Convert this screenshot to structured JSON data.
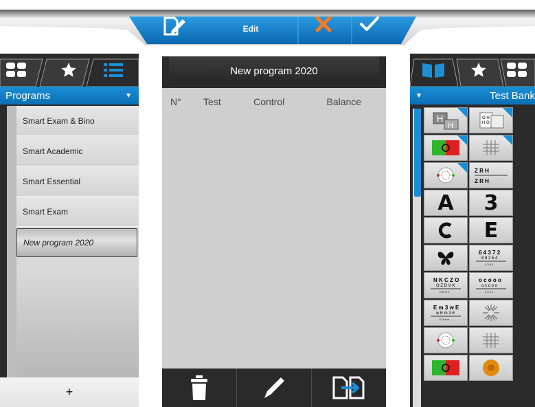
{
  "toolbar": {
    "edit_label": "Edit"
  },
  "left_panel": {
    "header_label": "Programs",
    "header_caret": "▼",
    "programs": [
      {
        "label": "Smart Exam & Bino"
      },
      {
        "label": "Smart Academic"
      },
      {
        "label": "Smart Essential"
      },
      {
        "label": "Smart Exam"
      },
      {
        "label": "New program 2020",
        "selected": true
      }
    ],
    "add_label": "+"
  },
  "center_panel": {
    "title": "New program 2020",
    "columns": {
      "no": "N°",
      "test": "Test",
      "control": "Control",
      "balance": "Balance"
    }
  },
  "right_panel": {
    "header_caret": "▼",
    "header_label": "Test Bank",
    "tiles": [
      {
        "icon": "h-duochrome-tile-icon",
        "flag": true
      },
      {
        "icon": "letter-grid-tile-icon",
        "flag": true
      },
      {
        "icon": "red-green-tile-icon",
        "flag": true
      },
      {
        "icon": "cross-grid-tile-icon",
        "flag": true
      },
      {
        "icon": "dot-circle-tile-icon",
        "flag": true
      },
      {
        "icon": "zrho-chart-tile-icon",
        "flag": false
      },
      {
        "icon": "letter-a-tile-icon",
        "text": "A"
      },
      {
        "icon": "letter-3-tile-icon",
        "text": "Ɛ"
      },
      {
        "icon": "landolt-c-tile-icon",
        "text": "C"
      },
      {
        "icon": "letter-e-tile-icon",
        "text": "E"
      },
      {
        "icon": "butterfly-tile-icon",
        "text": "🦋"
      },
      {
        "icon": "number-chart-tile-icon"
      },
      {
        "icon": "letter-chart-tile-icon"
      },
      {
        "icon": "landolt-chart-tile-icon"
      },
      {
        "icon": "e-chart-tile-icon"
      },
      {
        "icon": "fan-chart-tile-icon"
      },
      {
        "icon": "dot-circle-tile-icon"
      },
      {
        "icon": "cross-grid-tile-icon"
      },
      {
        "icon": "red-green-tile-icon"
      },
      {
        "icon": "orange-target-tile-icon"
      }
    ]
  },
  "colors": {
    "accent_blue": "#0b78c8",
    "cancel_orange": "#ff7a1a",
    "panel_dark": "#2b2b2b",
    "list_gray": "#d9d9d9"
  }
}
